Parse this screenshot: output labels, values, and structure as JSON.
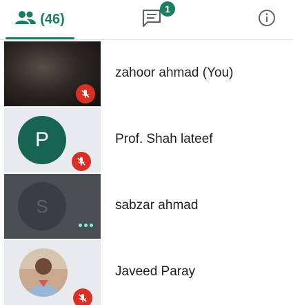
{
  "colors": {
    "accent": "#1a7f62",
    "teal_avatar": "#176550",
    "muted_red": "#d93025",
    "badge": "#1a7f62",
    "dots": "#7ef0cf"
  },
  "tabs": {
    "people": {
      "icon": "people-icon",
      "count": "(46)"
    },
    "chat": {
      "icon": "chat-icon",
      "badge": "1"
    },
    "info": {
      "icon": "info-icon"
    }
  },
  "participants": [
    {
      "name": "zahoor ahmad (You)",
      "tile": "video",
      "muted": true
    },
    {
      "name": "Prof. Shah lateef",
      "tile": "initial",
      "initial": "P",
      "muted": true
    },
    {
      "name": "sabzar ahmad",
      "tile": "initial-dark",
      "initial": "S",
      "more_icon": "more-dots-icon"
    },
    {
      "name": "Javeed Paray",
      "tile": "photo",
      "muted": true
    }
  ]
}
